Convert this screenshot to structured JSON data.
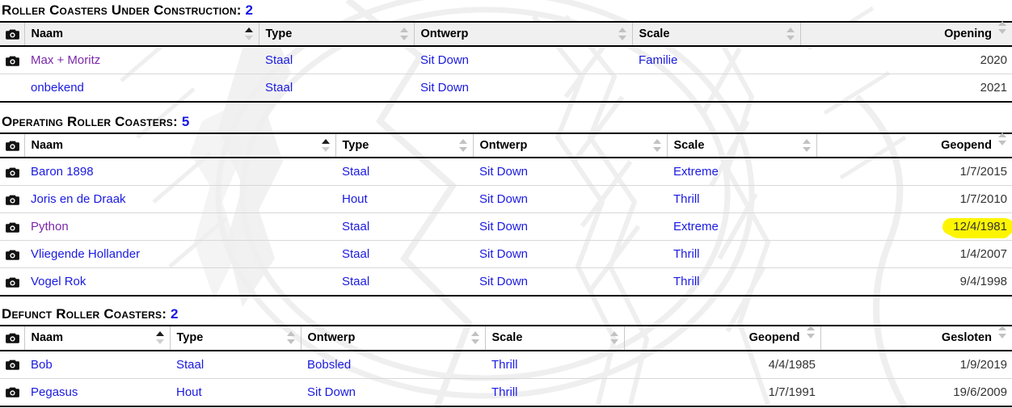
{
  "watermark": {
    "description": "faint light-gray map and emblem watermark",
    "color": "#efefef"
  },
  "colors": {
    "link": "#1a1ae0",
    "visited_link": "#7b28a8",
    "count": "#1818e8",
    "highlight": "#fdf500",
    "header_shaded_bg": "#f0f0f0"
  },
  "sections": [
    {
      "title_text": "Roller Coasters Under Construction:",
      "count": "2",
      "header_shaded": true,
      "columns": [
        {
          "label": "",
          "icon": "camera-icon",
          "sort": "none",
          "align": "left"
        },
        {
          "label": "Naam",
          "sort": "asc",
          "align": "left"
        },
        {
          "label": "Type",
          "sort": "none",
          "align": "left"
        },
        {
          "label": "Ontwerp",
          "sort": "none",
          "align": "left"
        },
        {
          "label": "Scale",
          "sort": "none",
          "align": "left"
        },
        {
          "label": "Opening",
          "sort": "none",
          "align": "right"
        }
      ],
      "rows": [
        {
          "camera": true,
          "naam": "Max + Moritz",
          "naam_visited": true,
          "type": "Staal",
          "ontwerp": "Sit Down",
          "scale": "Familie",
          "date1": "2020"
        },
        {
          "camera": false,
          "naam": "onbekend",
          "naam_visited": false,
          "type": "Staal",
          "ontwerp": "Sit Down",
          "scale": "",
          "date1": "2021"
        }
      ]
    },
    {
      "title_text": "Operating Roller Coasters:",
      "count": "5",
      "header_shaded": false,
      "columns": [
        {
          "label": "",
          "icon": "camera-icon",
          "sort": "none",
          "align": "left"
        },
        {
          "label": "Naam",
          "sort": "asc",
          "align": "left"
        },
        {
          "label": "Type",
          "sort": "none",
          "align": "left"
        },
        {
          "label": "Ontwerp",
          "sort": "none",
          "align": "left"
        },
        {
          "label": "Scale",
          "sort": "none",
          "align": "left"
        },
        {
          "label": "Geopend",
          "sort": "none",
          "align": "right"
        }
      ],
      "rows": [
        {
          "camera": true,
          "naam": "Baron 1898",
          "naam_visited": false,
          "type": "Staal",
          "ontwerp": "Sit Down",
          "scale": "Extreme",
          "date1": "1/7/2015",
          "highlight": false
        },
        {
          "camera": true,
          "naam": "Joris en de Draak",
          "naam_visited": false,
          "type": "Hout",
          "ontwerp": "Sit Down",
          "scale": "Thrill",
          "date1": "1/7/2010",
          "highlight": false
        },
        {
          "camera": true,
          "naam": "Python",
          "naam_visited": true,
          "type": "Staal",
          "ontwerp": "Sit Down",
          "scale": "Extreme",
          "date1": "12/4/1981",
          "highlight": true
        },
        {
          "camera": true,
          "naam": "Vliegende Hollander",
          "naam_visited": false,
          "type": "Staal",
          "ontwerp": "Sit Down",
          "scale": "Thrill",
          "date1": "1/4/2007",
          "highlight": false
        },
        {
          "camera": true,
          "naam": "Vogel Rok",
          "naam_visited": false,
          "type": "Staal",
          "ontwerp": "Sit Down",
          "scale": "Thrill",
          "date1": "9/4/1998",
          "highlight": false
        }
      ]
    },
    {
      "title_text": "Defunct Roller Coasters:",
      "count": "2",
      "header_shaded": false,
      "columns": [
        {
          "label": "",
          "icon": "camera-icon",
          "sort": "none",
          "align": "left"
        },
        {
          "label": "Naam",
          "sort": "asc",
          "align": "left"
        },
        {
          "label": "Type",
          "sort": "none",
          "align": "left"
        },
        {
          "label": "Ontwerp",
          "sort": "none",
          "align": "left"
        },
        {
          "label": "Scale",
          "sort": "none",
          "align": "left"
        },
        {
          "label": "Geopend",
          "sort": "none",
          "align": "right"
        },
        {
          "label": "Gesloten",
          "sort": "none",
          "align": "right"
        }
      ],
      "rows": [
        {
          "camera": true,
          "naam": "Bob",
          "naam_visited": false,
          "type": "Staal",
          "ontwerp": "Bobsled",
          "scale": "Thrill",
          "date1": "4/4/1985",
          "date2": "1/9/2019"
        },
        {
          "camera": true,
          "naam": "Pegasus",
          "naam_visited": false,
          "type": "Hout",
          "ontwerp": "Sit Down",
          "scale": "Thrill",
          "date1": "1/7/1991",
          "date2": "19/6/2009"
        }
      ]
    }
  ]
}
